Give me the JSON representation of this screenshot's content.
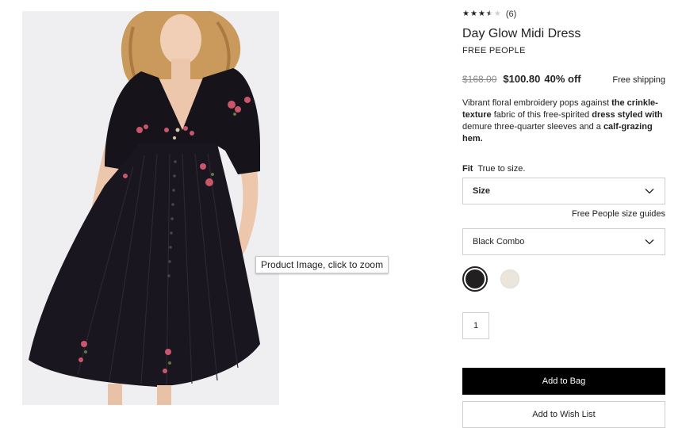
{
  "product": {
    "rating": {
      "stars": [
        "full",
        "full",
        "full",
        "half",
        "empty"
      ],
      "value": 3.5,
      "count_label": "(6)"
    },
    "title": "Day Glow Midi Dress",
    "brand": "FREE PEOPLE",
    "price": {
      "original": "$168.00",
      "sale": "$100.80",
      "discount": "40% off"
    },
    "shipping": "Free shipping",
    "description": [
      {
        "text": "Vibrant floral embroidery pops against ",
        "bold": false
      },
      {
        "text": "the crinkle-texture",
        "bold": true
      },
      {
        "text": " fabric of this free-spirited ",
        "bold": false
      },
      {
        "text": "dress styled with",
        "bold": true
      },
      {
        "text": " demure three-quarter sleeves and a ",
        "bold": false
      },
      {
        "text": "calf-grazing hem.",
        "bold": true
      }
    ]
  },
  "fit": {
    "label": "Fit",
    "value": "True to size."
  },
  "size_select": {
    "label": "Size",
    "icon": "chevron-down-icon"
  },
  "size_guide": "Free People size guides",
  "color_select": {
    "value": "Black Combo",
    "icon": "chevron-down-icon"
  },
  "swatches": [
    {
      "name": "black-combo",
      "color": "#221f20",
      "selected": true
    },
    {
      "name": "ivory",
      "color": "#ece5dc",
      "selected": false
    }
  ],
  "quantity": "1",
  "buttons": {
    "add_to_bag": "Add to Bag",
    "add_to_wish_list": "Add to Wish List"
  },
  "image": {
    "tooltip": "Product Image, click to zoom",
    "background": "#efeef1"
  },
  "colors": {
    "button_black": "#000000",
    "border": "#cfcfcf",
    "text": "#222222"
  }
}
